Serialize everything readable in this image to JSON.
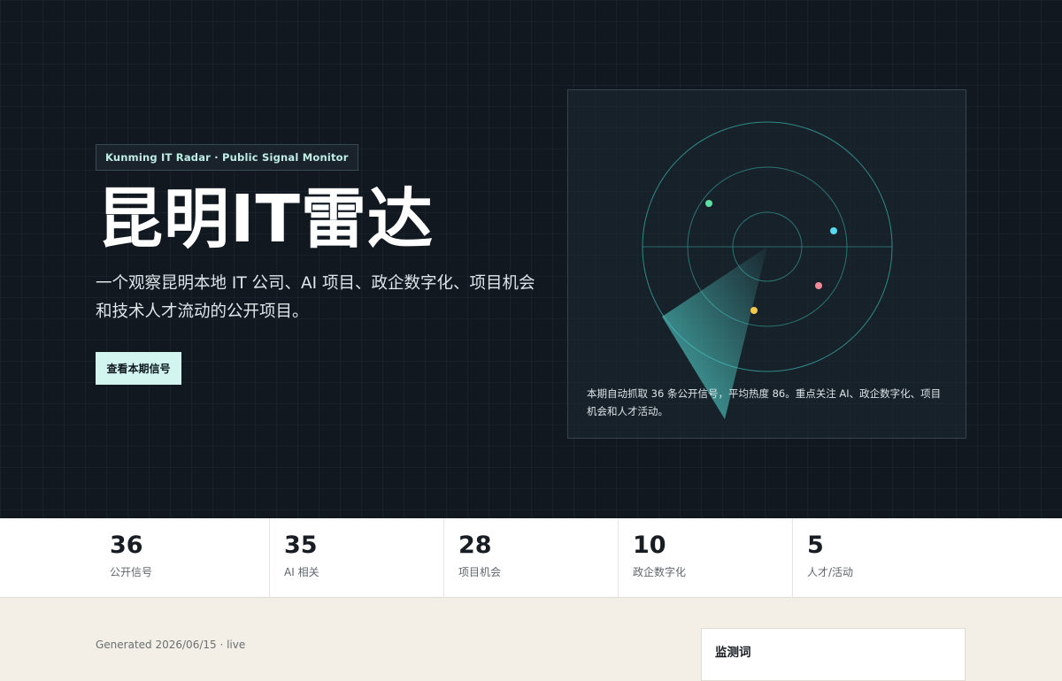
{
  "hero": {
    "badge": "Kunming IT Radar · Public Signal Monitor",
    "title": "昆明IT雷达",
    "subtitle": "一个观察昆明本地 IT 公司、AI 项目、政企数字化、项目机会和技术人才流动的公开项目。",
    "cta_label": "查看本期信号"
  },
  "radar": {
    "caption": "本期自动抓取 36 条公开信号，平均热度 86。重点关注 AI、政企数字化、项目机会和人才活动。",
    "dot_colors": [
      "#5de0a6",
      "#58d9f0",
      "#f08a96",
      "#f2c84b"
    ],
    "ring_color": "#2f8a88",
    "sweep_color": "#4fc9c4"
  },
  "stats": [
    {
      "value": "36",
      "label": "公开信号"
    },
    {
      "value": "35",
      "label": "AI 相关"
    },
    {
      "value": "28",
      "label": "项目机会"
    },
    {
      "value": "10",
      "label": "政企数字化"
    },
    {
      "value": "5",
      "label": "人才/活动"
    }
  ],
  "footer": {
    "generated": "Generated 2026/06/15 · live",
    "watch_title": "监测词"
  }
}
